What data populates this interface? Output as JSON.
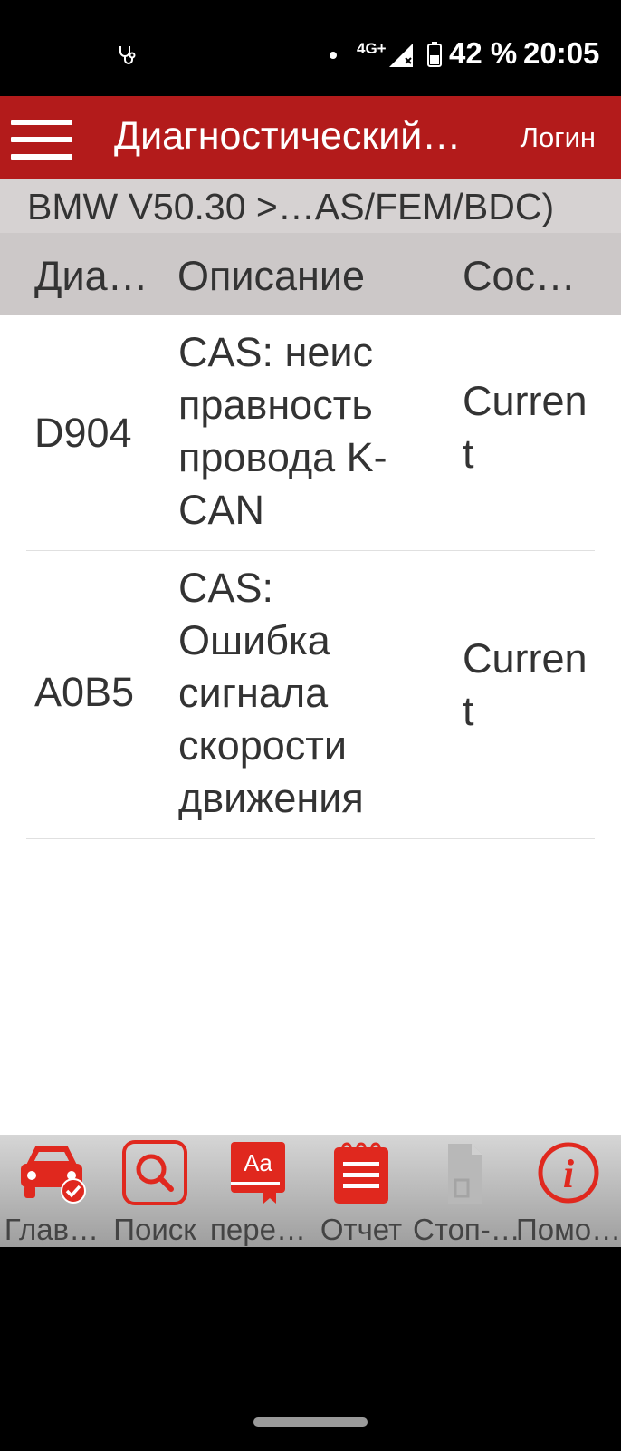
{
  "status_bar": {
    "network": "4G+",
    "battery": "42 %",
    "time": "20:05",
    "icons": [
      "stethoscope-icon",
      "signal-icon",
      "battery-icon"
    ]
  },
  "app_bar": {
    "title": "Диагностический…",
    "login_label": "Логин",
    "color": "#b31b1b"
  },
  "breadcrumb": "BMW V50.30 >…AS/FEM/BDC)",
  "table": {
    "headers": [
      "Диа…",
      "Описание",
      "Сос…"
    ],
    "rows": [
      {
        "code": "D904",
        "description": "CAS: неис правность провода K-CAN",
        "state": "Current"
      },
      {
        "code": "A0B5",
        "description": "CAS: Ошибка сигнала скорости движения",
        "state": "Current"
      }
    ]
  },
  "toolbar": {
    "items": [
      {
        "label": "Глав…",
        "icon": "car-icon"
      },
      {
        "label": "Поиск",
        "icon": "search-icon"
      },
      {
        "label": "пере…",
        "icon": "dictionary-icon"
      },
      {
        "label": "Отчет",
        "icon": "report-icon"
      },
      {
        "label": "Стоп-…",
        "icon": "document-icon"
      },
      {
        "label": "Помо…",
        "icon": "info-icon"
      }
    ],
    "accent": "#e0281e",
    "disabled_color": "#b0b0b0"
  }
}
